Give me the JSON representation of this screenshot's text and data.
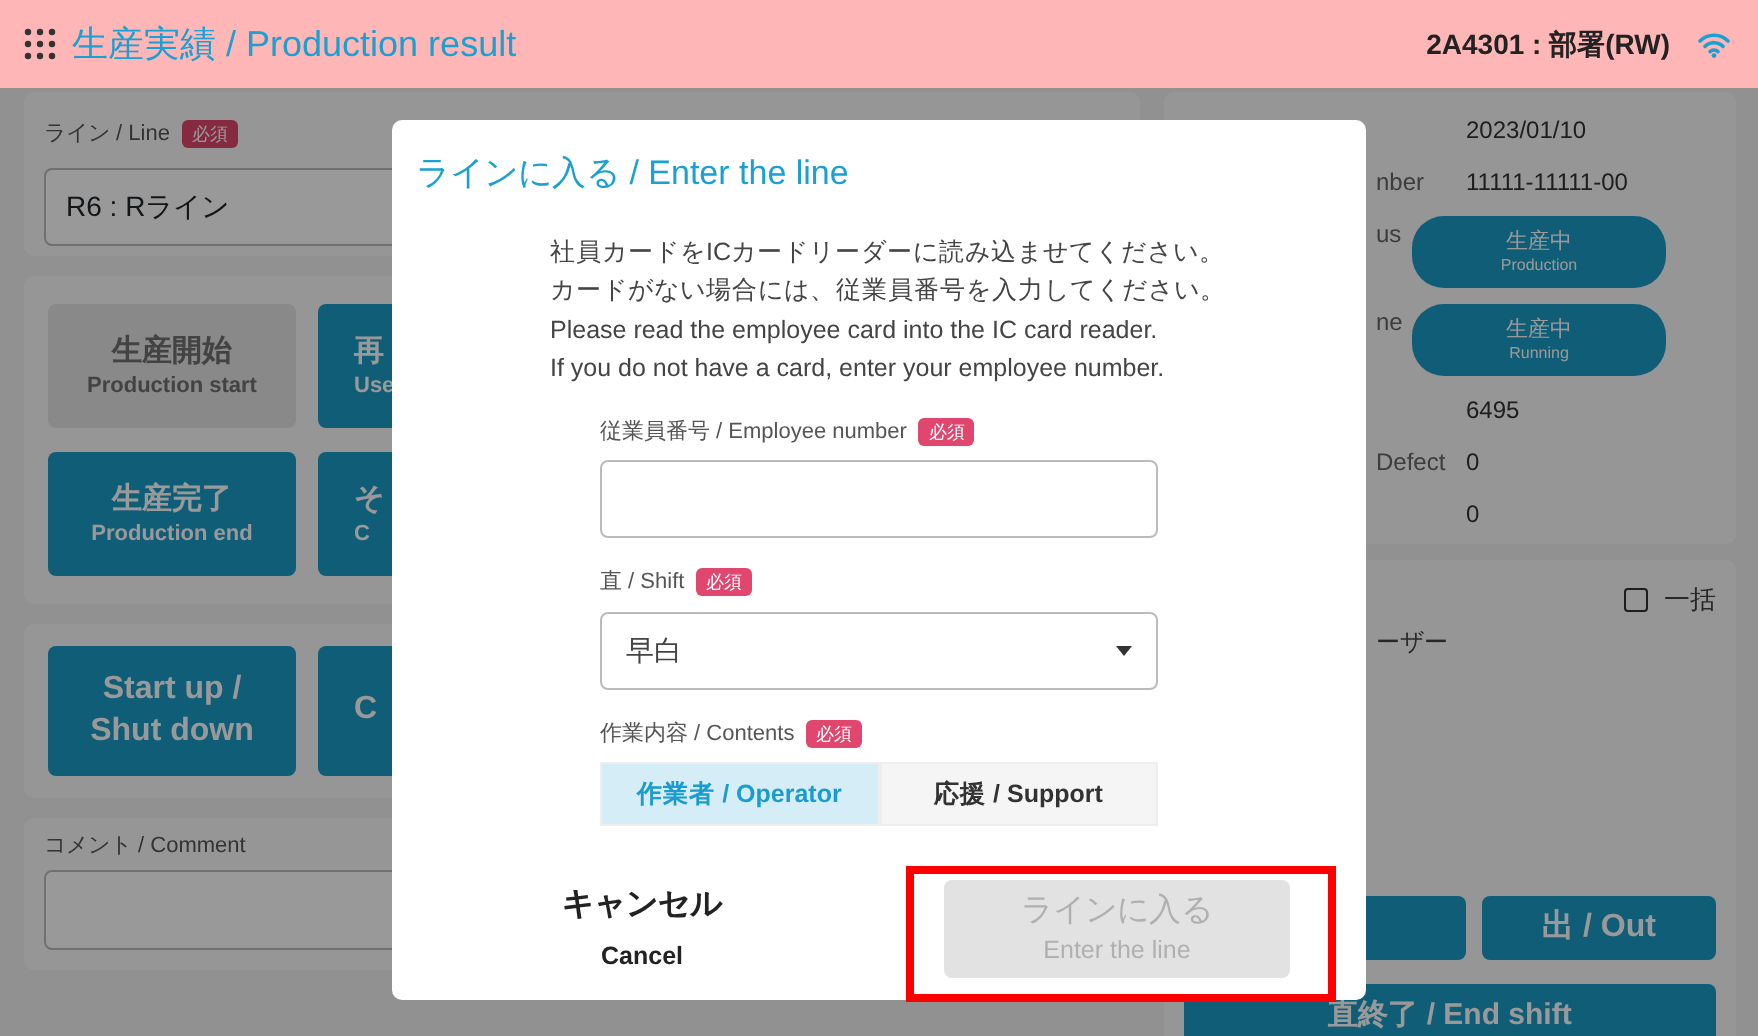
{
  "header": {
    "title": "生産実績 / Production result",
    "user": "2A4301 : 部署(RW)"
  },
  "line_panel": {
    "label": "ライン / Line",
    "required": "必須",
    "value": "R6 : Rライン"
  },
  "button_rows": [
    {
      "buttons": [
        {
          "main": "生産開始",
          "sub": "Production start",
          "disabled": true
        },
        {
          "main": "再",
          "sub": "Use",
          "disabled": false
        }
      ]
    },
    {
      "buttons": [
        {
          "main": "生産完了",
          "sub": "Production end",
          "disabled": false
        },
        {
          "main": "そ",
          "sub": "C",
          "disabled": false
        }
      ]
    }
  ],
  "startup_row": {
    "buttons": [
      {
        "main": "Start up /",
        "sub": "Shut down",
        "disabled": false
      },
      {
        "sub": "C",
        "disabled": false
      }
    ]
  },
  "comment": {
    "label": "コメント / Comment"
  },
  "info_rows": [
    {
      "kind": "text",
      "value": "2023/01/10"
    },
    {
      "kind": "text",
      "label": "nber",
      "value": "11111-11111-00"
    },
    {
      "kind": "pill",
      "label": "us",
      "main": "生産中",
      "sub": "Production"
    },
    {
      "kind": "pill",
      "label": "ne",
      "main": "生産中",
      "sub": "Running"
    },
    {
      "kind": "text",
      "value": "6495"
    },
    {
      "kind": "text",
      "label": "Defect",
      "value": "0"
    },
    {
      "kind": "text",
      "value": "0"
    }
  ],
  "member_panel": {
    "bulk": {
      "label": "一括",
      "checked": false
    },
    "column_fragment": "ーザー",
    "buttons": [
      {
        "label": "出 / Out"
      }
    ],
    "end_shift": "直終了 / End shift"
  },
  "dialog": {
    "title": "ラインに入る / Enter the line",
    "instructions": [
      "社員カードをICカードリーダーに読み込ませてください。",
      "カードがない場合には、従業員番号を入力してください。",
      "Please read the employee card into the IC card reader.",
      "If you do not have a card, enter your employee number."
    ],
    "employee": {
      "label": "従業員番号 / Employee number",
      "required": "必須"
    },
    "shift": {
      "label": "直 / Shift",
      "required": "必須",
      "value": "早白"
    },
    "contents": {
      "label": "作業内容 / Contents",
      "required": "必須",
      "options": [
        {
          "label": "作業者 / Operator",
          "selected": true
        },
        {
          "label": "応援 / Support",
          "selected": false
        }
      ]
    },
    "cancel": {
      "main": "キャンセル",
      "sub": "Cancel"
    },
    "enter": {
      "main": "ラインに入る",
      "sub": "Enter the line",
      "disabled": true,
      "highlighted": true
    }
  }
}
